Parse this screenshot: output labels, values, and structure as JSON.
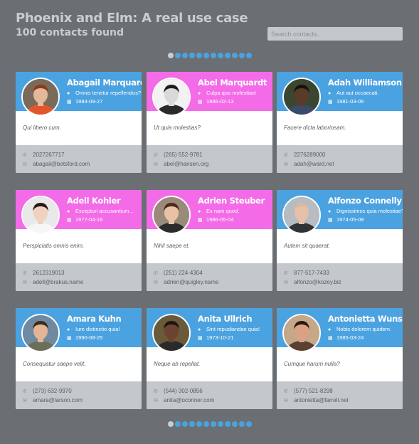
{
  "header": {
    "title": "Phoenix and Elm: A real use case",
    "subtitle": "100 contacts found"
  },
  "search": {
    "placeholder": "Search contacts...",
    "value": ""
  },
  "pagination": {
    "pages": 12,
    "current": 1
  },
  "colors": {
    "background": "#6b6f73",
    "male": "#4ba2e0",
    "female": "#f46be8",
    "footer": "#c4c7cb"
  },
  "contacts": [
    {
      "name": "Abagail Marquardt",
      "location": "Omnis tenetur repellendus?",
      "birth_date": "1984-09-27",
      "headline": "Qui libero cum.",
      "phone": "2027267717",
      "email": "abagail@botsford.com",
      "gender": "male"
    },
    {
      "name": "Abel Marquardt",
      "location": "Culpa quo molestias!",
      "birth_date": "1986-02-13",
      "headline": "Ut quia molestias?",
      "phone": "(265) 552-9781",
      "email": "abel@hansen.org",
      "gender": "female"
    },
    {
      "name": "Adah Williamson",
      "location": "Aut aut occaecati.",
      "birth_date": "1981-03-06",
      "headline": "Facere dicta laboriosam.",
      "phone": "2276289000",
      "email": "adah@ward.net",
      "gender": "male"
    },
    {
      "name": "Adell Kohler",
      "location": "Excepturi accusantium...",
      "birth_date": "1977-04-16",
      "headline": "Perspiciatis omnis enim.",
      "phone": "2612319013",
      "email": "adell@brakus.name",
      "gender": "female"
    },
    {
      "name": "Adrien Steuber",
      "location": "Ex nam quod.",
      "birth_date": "1986-05-04",
      "headline": "Nihil saepe et.",
      "phone": "(251) 224-4304",
      "email": "adrien@quigley.name",
      "gender": "female"
    },
    {
      "name": "Alfonzo Connelly",
      "location": "Dignissimos quia molestiae?",
      "birth_date": "1974-05-08",
      "headline": "Autem sit quaerat.",
      "phone": "877-517-7433",
      "email": "alfonzo@kozey.biz",
      "gender": "male"
    },
    {
      "name": "Amara Kuhn",
      "location": "Iure distinctio quia!",
      "birth_date": "1990-08-25",
      "headline": "Consequatur saepe velit.",
      "phone": "(273) 632-9970",
      "email": "amara@larson.com",
      "gender": "male"
    },
    {
      "name": "Anita Ullrich",
      "location": "Sint repudiandae quia!",
      "birth_date": "1973-10-21",
      "headline": "Neque ab repellat.",
      "phone": "(544) 302-0856",
      "email": "anita@oconner.com",
      "gender": "male"
    },
    {
      "name": "Antonietta Wunsch",
      "location": "Nobis dolorem quidem.",
      "birth_date": "1985-03-24",
      "headline": "Cumque harum nulla?",
      "phone": "(577) 521-8298",
      "email": "antonietta@farrell.net",
      "gender": "male"
    }
  ]
}
